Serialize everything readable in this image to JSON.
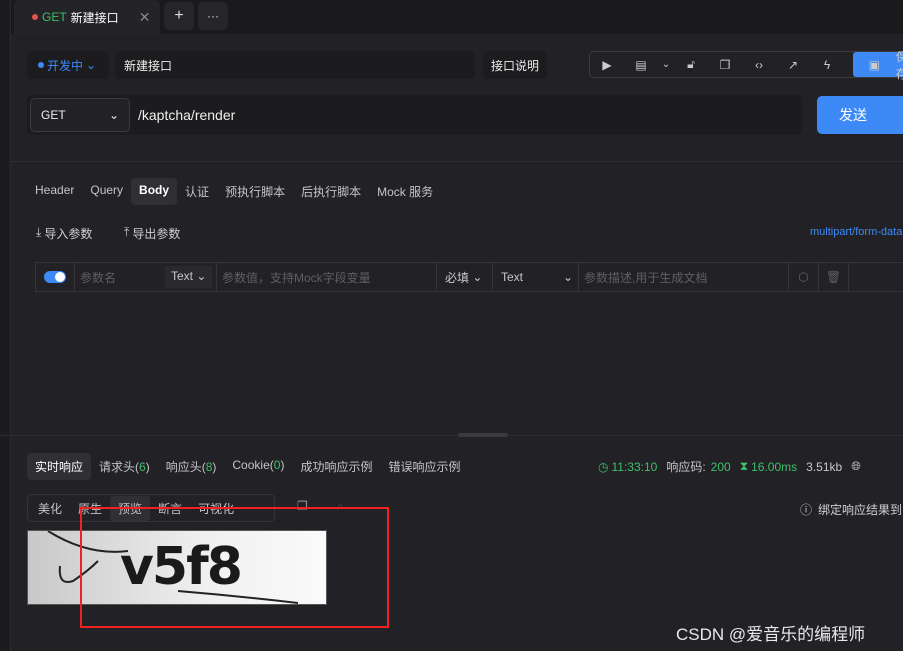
{
  "tab": {
    "method": "GET",
    "title": "新建接口",
    "close": "✕",
    "method_color": "#3fbf6a",
    "dot_color": "#e5534b"
  },
  "top_buttons": {
    "add": "+",
    "more": "···"
  },
  "status": {
    "label": "开发中",
    "color": "#3d8af7"
  },
  "api_name": "新建接口",
  "api_doc_button": "接口说明",
  "save_button": "保存",
  "request": {
    "method": "GET",
    "url": "/kaptcha/render",
    "send": "发送"
  },
  "request_tabs": [
    "Header",
    "Query",
    "Body",
    "认证",
    "预执行脚本",
    "后执行脚本",
    "Mock 服务"
  ],
  "active_request_tab": "Body",
  "import_params": "导入参数",
  "export_params": "导出参数",
  "content_type": "multipart/form-data",
  "param_row": {
    "name_placeholder": "参数名",
    "type": "Text",
    "value_placeholder": "参数值，支持Mock字段变量",
    "required": "必填",
    "value_type": "Text",
    "desc_placeholder": "参数描述,用于生成文档"
  },
  "response_tabs": {
    "realtime": "实时响应",
    "req_headers": "请求头(",
    "req_headers_count": "6",
    "res_headers": "响应头(",
    "res_headers_count": "8",
    "cookie": "Cookie(",
    "cookie_count": "0",
    "close_paren": ")",
    "success_example": "成功响应示例",
    "error_example": "错误响应示例"
  },
  "response_meta": {
    "time": "11:33:10",
    "code_label": "响应码:",
    "code": "200",
    "duration": "16.00ms",
    "size": "3.51kb"
  },
  "view_tabs": [
    "美化",
    "原生",
    "预览",
    "断言",
    "可视化"
  ],
  "active_view_tab": "预览",
  "bind_result": "绑定响应结果到",
  "captcha_text": "v5f8",
  "watermark": "CSDN @爱音乐的编程师"
}
